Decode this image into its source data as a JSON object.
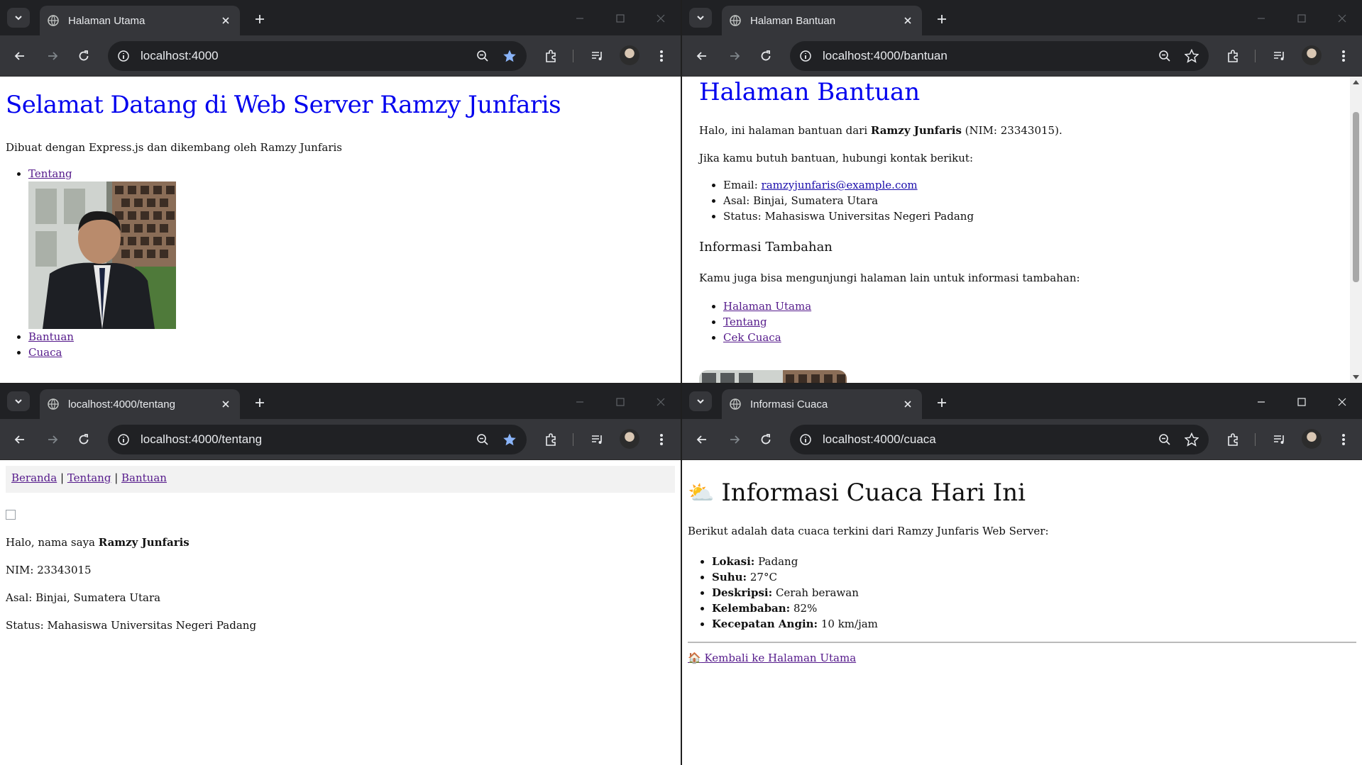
{
  "windows": {
    "tl": {
      "tab_title": "Halaman Utama",
      "url": "localhost:4000",
      "page": {
        "heading": "Selamat Datang di Web Server Ramzy Junfaris",
        "subtitle": "Dibuat dengan Express.js dan dikembang oleh Ramzy Junfaris",
        "links": [
          "Tentang",
          "Bantuan",
          "Cuaca"
        ]
      }
    },
    "tr": {
      "tab_title": "Halaman Bantuan",
      "url": "localhost:4000/bantuan",
      "page": {
        "heading": "Halaman Bantuan",
        "intro_prefix": "Halo, ini halaman bantuan dari ",
        "intro_name": "Ramzy Junfaris",
        "intro_suffix": " (NIM: 23343015).",
        "contact_intro": "Jika kamu butuh bantuan, hubungi kontak berikut:",
        "email_label": "Email: ",
        "email": "ramzyjunfaris@example.com",
        "asal": "Asal: Binjai, Sumatera Utara",
        "status": "Status: Mahasiswa Universitas Negeri Padang",
        "subheading": "Informasi Tambahan",
        "extra_intro": "Kamu juga bisa mengunjungi halaman lain untuk informasi tambahan:",
        "links": [
          "Halaman Utama",
          "Tentang",
          "Cek Cuaca"
        ]
      }
    },
    "bl": {
      "tab_title": "localhost:4000/tentang",
      "url": "localhost:4000/tentang",
      "page": {
        "nav": [
          "Beranda",
          "Tentang",
          "Bantuan"
        ],
        "nav_sep": " | ",
        "greet_prefix": "Halo, nama saya ",
        "greet_name": "Ramzy Junfaris",
        "nim": "NIM: 23343015",
        "asal": "Asal: Binjai, Sumatera Utara",
        "status": "Status: Mahasiswa Universitas Negeri Padang"
      }
    },
    "br": {
      "tab_title": "Informasi Cuaca",
      "url": "localhost:4000/cuaca",
      "page": {
        "heading_icon": "⛅",
        "heading": "Informasi Cuaca Hari Ini",
        "intro": "Berikut adalah data cuaca terkini dari Ramzy Junfaris Web Server:",
        "items": [
          {
            "label": "Lokasi:",
            "value": " Padang"
          },
          {
            "label": "Suhu:",
            "value": " 27°C"
          },
          {
            "label": "Deskripsi:",
            "value": " Cerah berawan"
          },
          {
            "label": "Kelembaban:",
            "value": " 82%"
          },
          {
            "label": "Kecepatan Angin:",
            "value": " 10 km/jam"
          }
        ],
        "back_icon": "🏠",
        "back_link": " Kembali ke Halaman Utama"
      }
    }
  },
  "icons": {
    "tab_list": "chevron-down-icon",
    "favicon": "globe-icon",
    "close": "close-icon",
    "new_tab": "plus-icon",
    "back": "arrow-left-icon",
    "forward": "arrow-right-icon",
    "reload": "reload-icon",
    "site_info": "info-icon",
    "zoom": "zoom-icon",
    "bookmark": "star-icon",
    "extensions": "puzzle-icon",
    "media": "media-control-icon",
    "menu": "kebab-menu-icon"
  },
  "colors": {
    "chrome_dark": "#202124",
    "chrome_toolbar": "#35363a",
    "link_blue": "#0000ee",
    "link_visited": "#551a8b",
    "bookmark_active": "#8ab4f8"
  }
}
